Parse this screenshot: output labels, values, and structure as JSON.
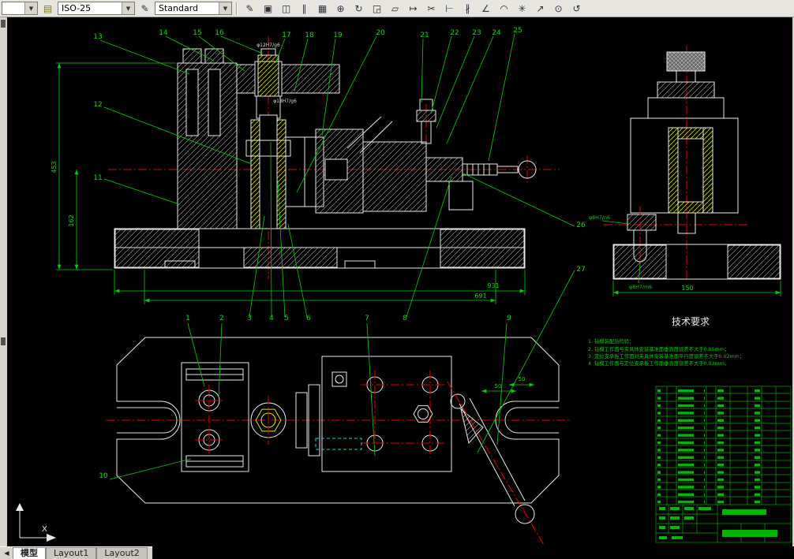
{
  "colors": {
    "canvas_bg": "#000000",
    "chrome_bg": "#e7e5df",
    "line_white": "#e9e9e9",
    "line_green": "#00cc00",
    "line_red": "#e00000",
    "line_yellow": "#e6e600",
    "line_cyan": "#00dddd"
  },
  "toolbar": {
    "left_combo_value": "",
    "dim_style_value": "ISO-25",
    "text_style_value": "Standard",
    "dim_style_button_glyph": "▤",
    "text_style_button_glyph": "✎",
    "combo_arrow_glyph": "▼",
    "buttons": [
      {
        "name": "erase",
        "glyph": "✎"
      },
      {
        "name": "copy",
        "glyph": "▣"
      },
      {
        "name": "mirror",
        "glyph": "◫"
      },
      {
        "name": "offset",
        "glyph": "∥"
      },
      {
        "name": "array",
        "glyph": "▦"
      },
      {
        "name": "move",
        "glyph": "⊕"
      },
      {
        "name": "rotate",
        "glyph": "↻"
      },
      {
        "name": "scale",
        "glyph": "◲"
      },
      {
        "name": "stretch",
        "glyph": "▱"
      },
      {
        "name": "lengthen",
        "glyph": "↦"
      },
      {
        "name": "trim",
        "glyph": "✂"
      },
      {
        "name": "extend",
        "glyph": "⊢"
      },
      {
        "name": "break",
        "glyph": "∦"
      },
      {
        "name": "chamfer",
        "glyph": "∠"
      },
      {
        "name": "fillet",
        "glyph": "◠"
      },
      {
        "name": "explode",
        "glyph": "✳"
      },
      {
        "name": "leader",
        "glyph": "↗"
      },
      {
        "name": "center-mark",
        "glyph": "⊙"
      },
      {
        "name": "update",
        "glyph": "↺"
      }
    ]
  },
  "tabs": {
    "nav_glyph": "◀",
    "model": "模型",
    "layout1": "Layout1",
    "layout2": "Layout2"
  },
  "ucs": {
    "x_label": "X"
  },
  "drawing": {
    "balloons": [
      "1",
      "2",
      "3",
      "4",
      "5",
      "6",
      "7",
      "8",
      "9",
      "10",
      "11",
      "12",
      "13",
      "14",
      "15",
      "16",
      "17",
      "18",
      "19",
      "20",
      "21",
      "22",
      "23",
      "24",
      "25",
      "26",
      "27"
    ],
    "dimensions": {
      "total_width": "931",
      "inner_width": "691",
      "left_height": "453",
      "left_height2": "162",
      "side_base_width": "150",
      "plan_dim_a": "50",
      "plan_dim_b": "50"
    },
    "fit_labels": {
      "bush_top": "φ12H7/g6",
      "bush_mid": "φ18H7/g6",
      "side_pin": "φ8H7/n6",
      "side_pin2": "φ8H7/m6"
    },
    "tech_requirements": {
      "title": "技术要求",
      "items": [
        "1. 钻模装配后检验；",
        "2. 钻模工作面与夹具体安装基准面垂直度误差不大于0.05mm；",
        "3. 定位支承板工作面对夹具体安装基准面平行度误差不大于0.02mm；",
        "4. 钻模工作面与定位支承板工作面垂直度误差不大于0.03mm。"
      ]
    }
  }
}
